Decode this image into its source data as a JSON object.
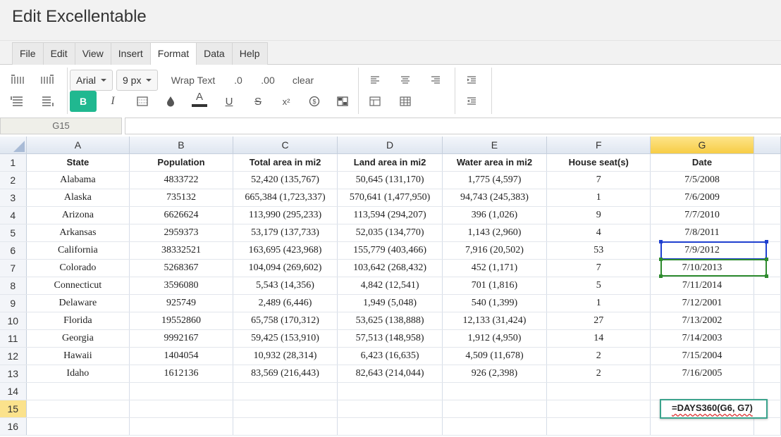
{
  "app": {
    "title": "Edit Excellentable"
  },
  "menu": [
    "File",
    "Edit",
    "View",
    "Insert",
    "Format",
    "Data",
    "Help"
  ],
  "menu_active": "Format",
  "toolbar": {
    "font_name": "Arial",
    "font_size": "9 px",
    "wrap_text": "Wrap Text",
    "decimal_decrease": ".0",
    "decimal_increase": ".00",
    "clear": "clear",
    "bold": "B",
    "italic": "I",
    "text_color": "A",
    "underline": "U",
    "strike": "S",
    "superscript": "x²",
    "accent_color": "#20b890"
  },
  "formula_bar": {
    "cell_ref": "G15",
    "value": ""
  },
  "sheet": {
    "columns": [
      "A",
      "B",
      "C",
      "D",
      "E",
      "F",
      "G"
    ],
    "selected_column": "G",
    "selected_row": "15",
    "row_numbers": [
      "1",
      "2",
      "3",
      "4",
      "5",
      "6",
      "7",
      "8",
      "9",
      "10",
      "11",
      "12",
      "13",
      "14",
      "15",
      "16"
    ],
    "rows": [
      [
        "State",
        "Population",
        "Total area in mi2",
        "Land area in mi2",
        "Water area in mi2",
        "House seat(s)",
        "Date"
      ],
      [
        "Alabama",
        "4833722",
        "52,420 (135,767)",
        "50,645 (131,170)",
        "1,775 (4,597)",
        "7",
        "7/5/2008"
      ],
      [
        "Alaska",
        "735132",
        "665,384 (1,723,337)",
        "570,641 (1,477,950)",
        "94,743 (245,383)",
        "1",
        "7/6/2009"
      ],
      [
        "Arizona",
        "6626624",
        "113,990 (295,233)",
        "113,594 (294,207)",
        "396 (1,026)",
        "9",
        "7/7/2010"
      ],
      [
        "Arkansas",
        "2959373",
        "53,179 (137,733)",
        "52,035 (134,770)",
        "1,143 (2,960)",
        "4",
        "7/8/2011"
      ],
      [
        "California",
        "38332521",
        "163,695 (423,968)",
        "155,779 (403,466)",
        "7,916 (20,502)",
        "53",
        "7/9/2012"
      ],
      [
        "Colorado",
        "5268367",
        "104,094 (269,602)",
        "103,642 (268,432)",
        "452 (1,171)",
        "7",
        "7/10/2013"
      ],
      [
        "Connecticut",
        "3596080",
        "5,543 (14,356)",
        "4,842 (12,541)",
        "701 (1,816)",
        "5",
        "7/11/2014"
      ],
      [
        "Delaware",
        "925749",
        "2,489 (6,446)",
        "1,949 (5,048)",
        "540 (1,399)",
        "1",
        "7/12/2001"
      ],
      [
        "Florida",
        "19552860",
        "65,758 (170,312)",
        "53,625 (138,888)",
        "12,133 (31,424)",
        "27",
        "7/13/2002"
      ],
      [
        "Georgia",
        "9992167",
        "59,425 (153,910)",
        "57,513 (148,958)",
        "1,912 (4,950)",
        "14",
        "7/14/2003"
      ],
      [
        "Hawaii",
        "1404054",
        "10,932 (28,314)",
        "6,423 (16,635)",
        "4,509 (11,678)",
        "2",
        "7/15/2004"
      ],
      [
        "Idaho",
        "1612136",
        "83,569 (216,443)",
        "82,643 (214,044)",
        "926 (2,398)",
        "2",
        "7/16/2005"
      ],
      [
        "",
        "",
        "",
        "",
        "",
        "",
        ""
      ],
      [
        "",
        "",
        "",
        "",
        "",
        "",
        ""
      ],
      [
        "",
        "",
        "",
        "",
        "",
        "",
        ""
      ]
    ],
    "editing_formula": "=DAYS360(G6, G7)",
    "colors": {
      "range_primary": "#1f3fcf",
      "range_secondary": "#2e8b2e",
      "editor_border": "#3aa38c",
      "selected_header": "#f7cd45"
    }
  }
}
